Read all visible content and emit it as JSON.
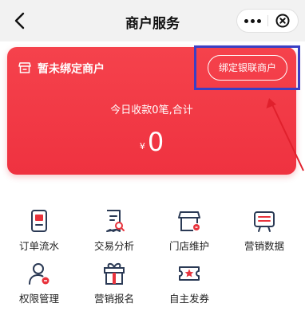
{
  "header": {
    "title": "商户服务",
    "back_icon": "back-arrow-icon",
    "more_icon": "more-dots-icon",
    "close_icon": "close-circle-icon"
  },
  "card": {
    "status": "暂未绑定商户",
    "bind_button": "绑定银联商户",
    "summary": "今日收款0笔,合计",
    "currency": "¥",
    "amount": "0"
  },
  "grid": [
    {
      "label": "订单流水",
      "icon": "phone-receipt-icon"
    },
    {
      "label": "交易分析",
      "icon": "receipt-search-icon"
    },
    {
      "label": "门店维护",
      "icon": "store-wrench-icon"
    },
    {
      "label": "营销数据",
      "icon": "marketing-data-icon"
    },
    {
      "label": "权限管理",
      "icon": "user-permission-icon"
    },
    {
      "label": "营销报名",
      "icon": "gift-signup-icon"
    },
    {
      "label": "自主发券",
      "icon": "coupon-star-icon"
    }
  ],
  "colors": {
    "card_red": "#f03a45",
    "nav_bg": "#f2f2f2",
    "annotation_blue": "#3a3fc4",
    "annotation_red": "#e0202c",
    "icon_navy": "#2b3a55",
    "icon_red": "#e8333c"
  }
}
